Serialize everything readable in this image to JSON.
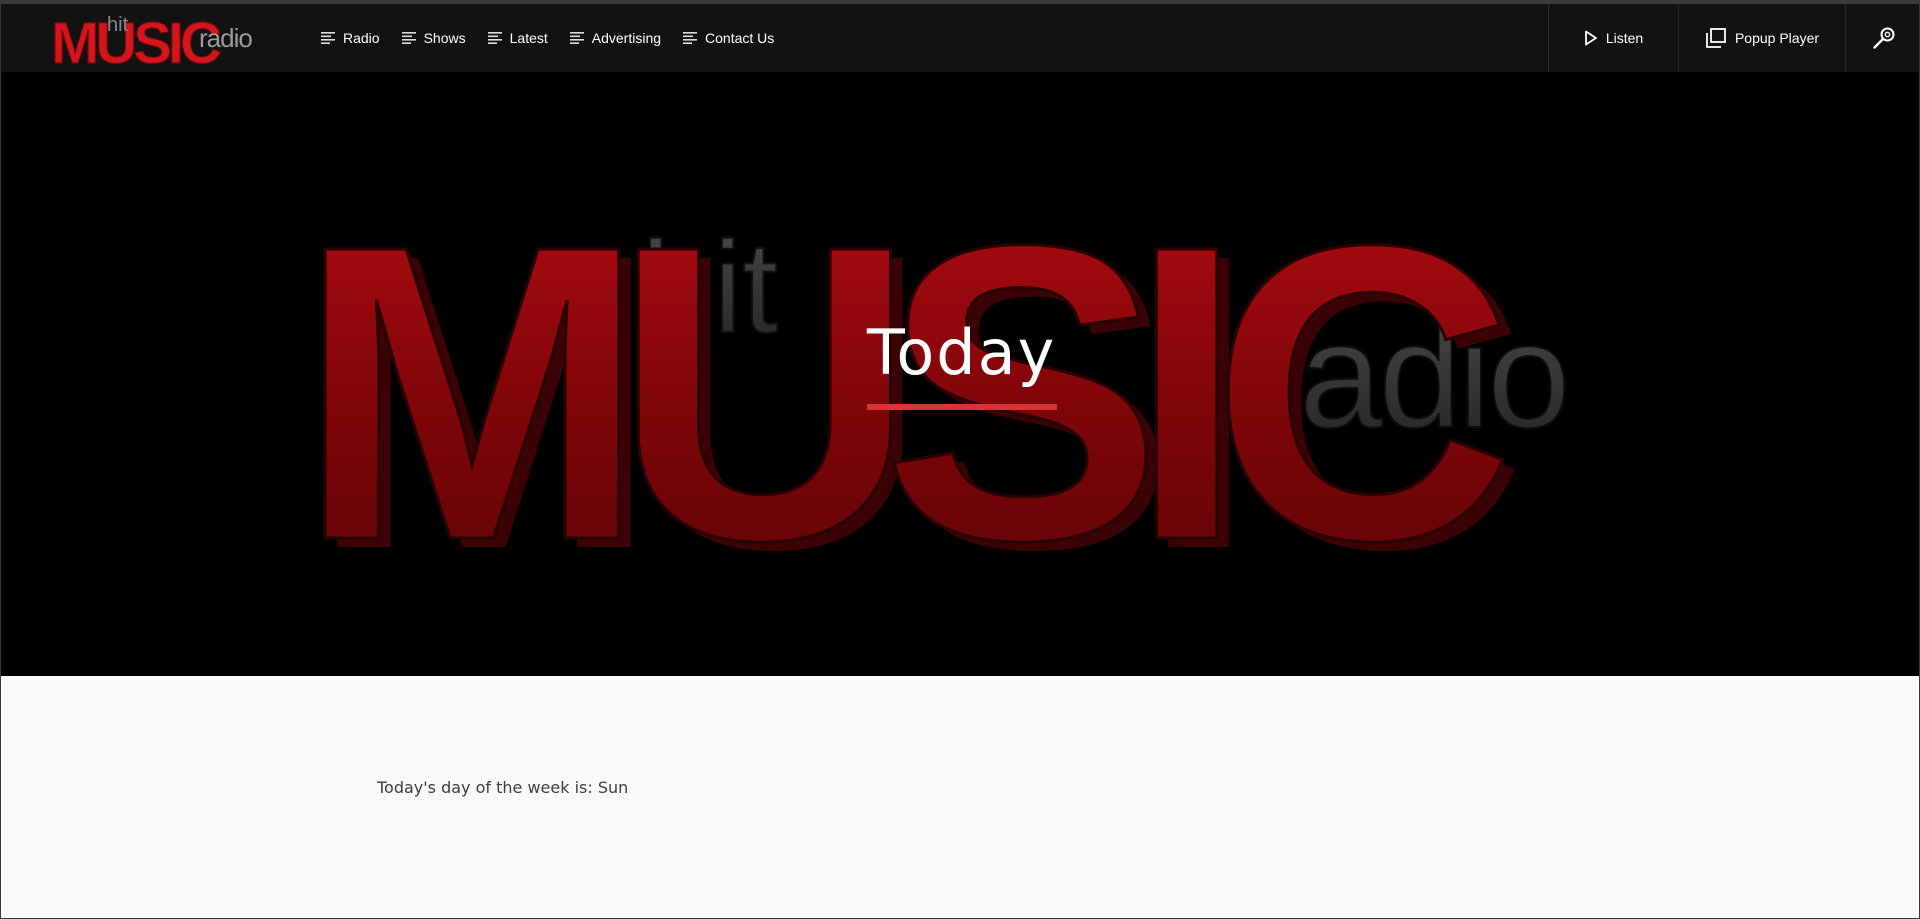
{
  "header": {
    "logo": {
      "small_word": "hit",
      "main_word": "MUSIC",
      "tail_word": "radio"
    },
    "nav": [
      {
        "label": "Radio"
      },
      {
        "label": "Shows"
      },
      {
        "label": "Latest"
      },
      {
        "label": "Advertising"
      },
      {
        "label": "Contact Us"
      }
    ],
    "actions": {
      "listen_label": "Listen",
      "popup_label": "Popup Player"
    }
  },
  "hero": {
    "title": "Today",
    "art": {
      "small_word": "hit",
      "main_word": "MUSIC",
      "tail_word": "radio"
    },
    "accent_color": "#d9333a"
  },
  "content": {
    "day_text": "Today's day of the week is: Sun"
  },
  "colors": {
    "topbar_bg": "#121212",
    "hero_bg": "#000000",
    "brand_red": "#c8141a",
    "page_bg": "#f8f9fb"
  }
}
